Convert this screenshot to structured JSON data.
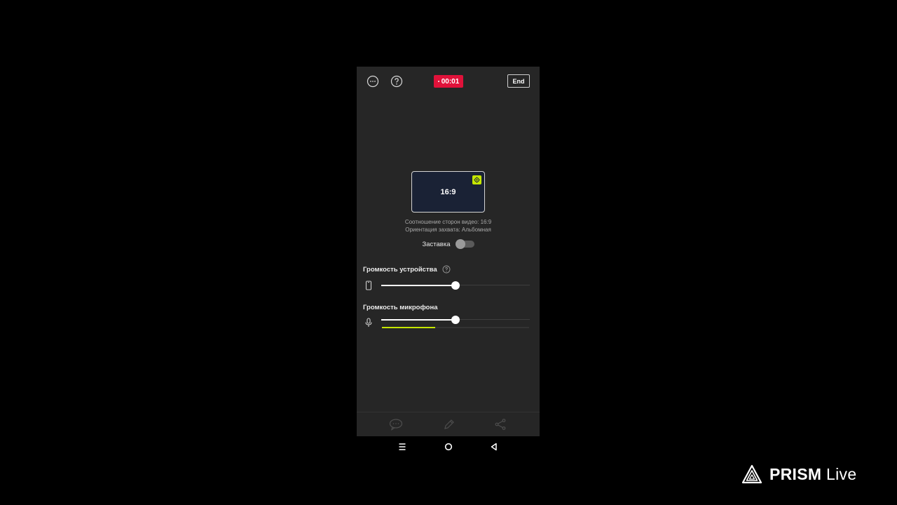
{
  "top_bar": {
    "rec_time": "00:01",
    "end_label": "End"
  },
  "preview": {
    "ratio_label": "16:9",
    "info_aspect": "Соотношение сторон видео: 16:9",
    "info_orientation": "Ориентация захвата: Альбомная"
  },
  "splash": {
    "label": "Заставка",
    "enabled": false
  },
  "device_volume": {
    "label": "Громкость устройства",
    "value": 0.5
  },
  "mic_volume": {
    "label": "Громкость микрофона",
    "value": 0.5,
    "level": 0.36
  },
  "watermark": {
    "brand_bold": "PRISM",
    "brand_light": "Live"
  },
  "colors": {
    "record_red": "#e0123a",
    "accent_lime": "#c5e600",
    "panel_bg": "#262626"
  }
}
